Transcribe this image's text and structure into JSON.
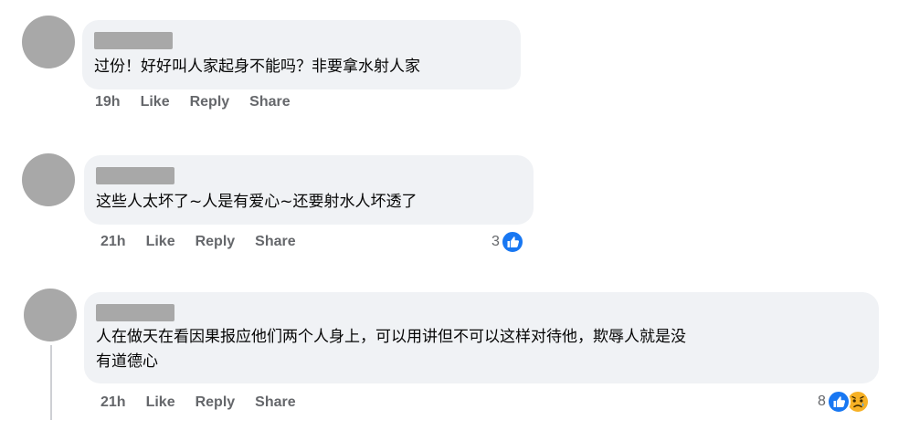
{
  "comments": [
    {
      "text": "过份！好好叫人家起身不能吗？非要拿水射人家",
      "time": "19h",
      "like_label": "Like",
      "reply_label": "Reply",
      "share_label": "Share"
    },
    {
      "text": "这些人太坏了~人是有爱心~还要射水人坏透了",
      "time": "21h",
      "like_label": "Like",
      "reply_label": "Reply",
      "share_label": "Share",
      "reaction_count": "3",
      "reactions": [
        "like-icon"
      ]
    },
    {
      "text_line1": "人在做天在看因果报应他们两个人身上，可以用讲但不可以这样对待他，欺辱人就是没",
      "text_line2": "有道德心",
      "time": "21h",
      "like_label": "Like",
      "reply_label": "Reply",
      "share_label": "Share",
      "reaction_count": "8",
      "reactions": [
        "like-icon",
        "sad-icon"
      ]
    }
  ],
  "colors": {
    "bubble": "#f0f2f5",
    "avatar": "#a8a8a8",
    "meta_text": "#65676b",
    "like_blue": "#1877f2",
    "sad_yellow": "#f7b125"
  }
}
